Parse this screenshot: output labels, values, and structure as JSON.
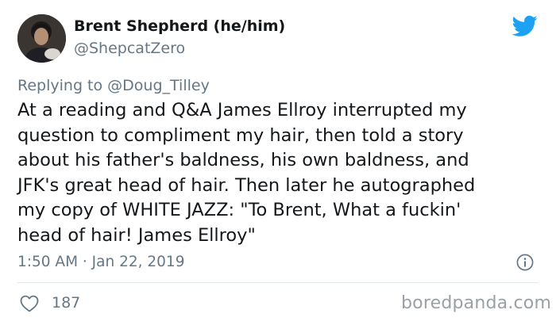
{
  "author": {
    "name": "Brent Shepherd (he/him)",
    "handle": "@ShepcatZero"
  },
  "reply": {
    "prefix": "Replying to",
    "handle": "@Doug_Tilley"
  },
  "tweet": {
    "lines": [
      "At a reading and Q&A James Ellroy interrupted my",
      "question to compliment my hair, then told a story",
      "about his father's baldness, his own baldness, and",
      "JFK's great head of hair. Then later he autographed",
      "my copy of WHITE JAZZ: \"To Brent, What a fuckin'",
      "head of hair! James Ellroy\""
    ],
    "timestamp": "1:50 AM · Jan 22, 2019"
  },
  "stats": {
    "likes": "187"
  },
  "icons": {
    "brand": "twitter-bird-icon",
    "info": "info-icon",
    "like": "heart-icon"
  },
  "colors": {
    "twitter_blue": "#1da1f2",
    "secondary_text": "#657786",
    "primary_text": "#14171a"
  },
  "watermark": "boredpanda.com"
}
